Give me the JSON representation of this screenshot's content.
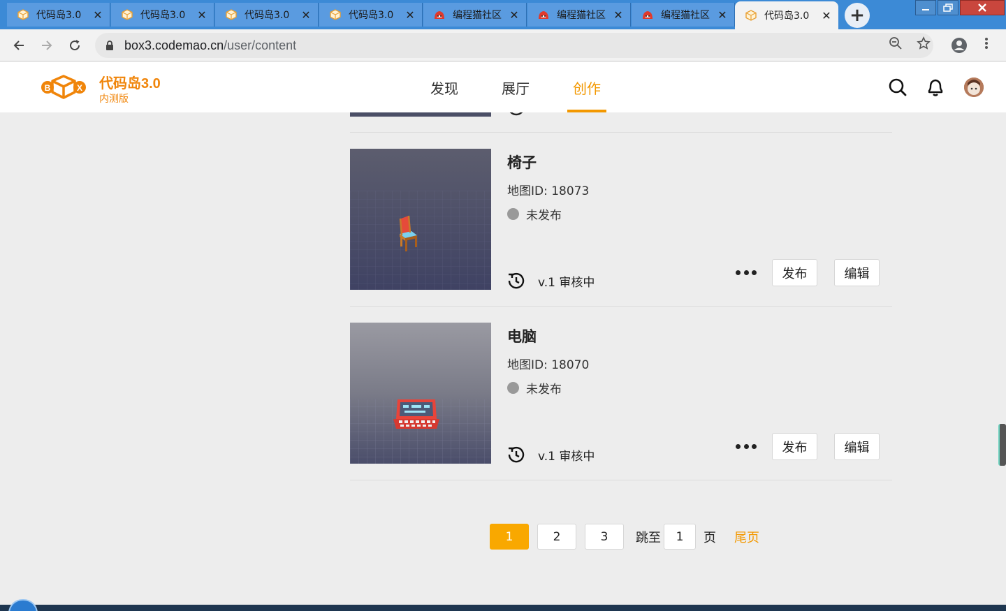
{
  "browser": {
    "tabs": [
      {
        "title": "代码岛3.0",
        "icon": "box-icon",
        "active": false
      },
      {
        "title": "代码岛3.0",
        "icon": "box-icon",
        "active": false
      },
      {
        "title": "代码岛3.0",
        "icon": "box-icon",
        "active": false
      },
      {
        "title": "代码岛3.0",
        "icon": "box-icon",
        "active": false
      },
      {
        "title": "编程猫社区",
        "icon": "codemao-icon",
        "active": false
      },
      {
        "title": "编程猫社区",
        "icon": "codemao-icon",
        "active": false
      },
      {
        "title": "编程猫社区",
        "icon": "codemao-icon",
        "active": false
      },
      {
        "title": "代码岛3.0",
        "icon": "box-icon",
        "active": true
      }
    ],
    "close_glyph": "✕",
    "new_tab_glyph": "+",
    "url_host": "box3.codemao.cn",
    "url_path": "/user/content"
  },
  "site": {
    "brand_name": "代码岛3.0",
    "brand_sub": "内测版",
    "logo_letters": [
      "B",
      "X"
    ],
    "nav": [
      {
        "label": "发现",
        "active": false
      },
      {
        "label": "展厅",
        "active": false
      },
      {
        "label": "创作",
        "active": true
      }
    ],
    "accent_color": "#f39800"
  },
  "works": [
    {
      "title": "椅子",
      "map_id": "地图ID: 18073",
      "status": "未发布",
      "version": "v.1 审核中",
      "publish_label": "发布",
      "edit_label": "编辑",
      "thumb_icon": "chair-model"
    },
    {
      "title": "电脑",
      "map_id": "地图ID: 18070",
      "status": "未发布",
      "version": "v.1 审核中",
      "publish_label": "发布",
      "edit_label": "编辑",
      "thumb_icon": "computer-model"
    }
  ],
  "pagination": {
    "pages": [
      "1",
      "2",
      "3"
    ],
    "current": "1",
    "jump_label": "跳至",
    "jump_value": "1",
    "page_unit": "页",
    "last_label": "尾页"
  }
}
